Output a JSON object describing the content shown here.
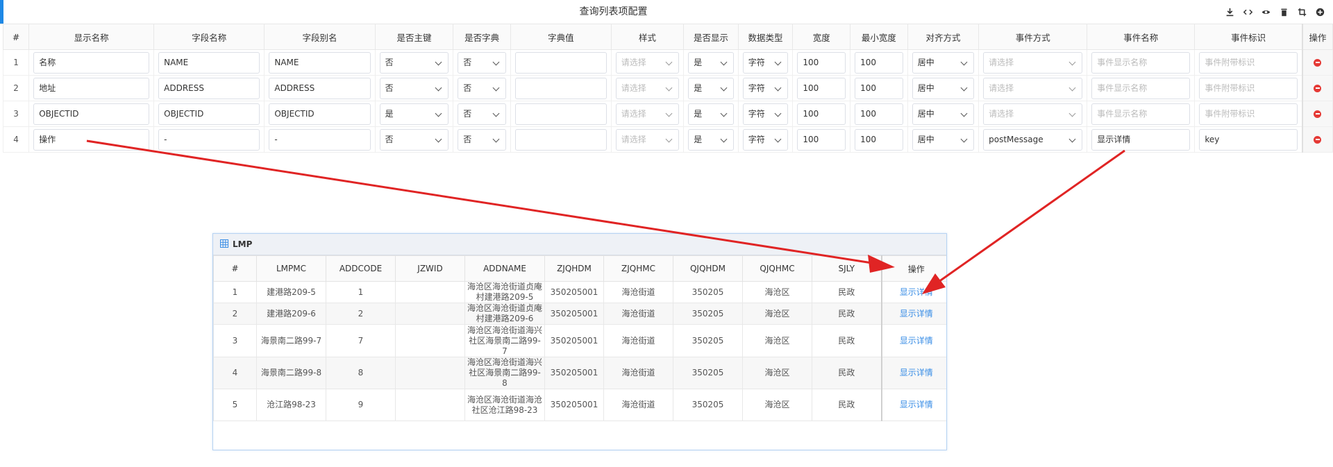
{
  "window": {
    "title": "查询列表项配置"
  },
  "toolbar_icons": [
    "download-icon",
    "code-icon",
    "eye-icon",
    "trash-icon",
    "crop-icon",
    "add-circle-icon"
  ],
  "config_table": {
    "headers": [
      "#",
      "显示名称",
      "字段名称",
      "字段别名",
      "是否主键",
      "是否字典",
      "字典值",
      "样式",
      "是否显示",
      "数据类型",
      "宽度",
      "最小宽度",
      "对齐方式",
      "事件方式",
      "事件名称",
      "事件标识",
      "操作"
    ],
    "placeholders": {
      "style": "请选择",
      "event_mode": "请选择",
      "event_name": "事件显示名称",
      "event_key": "事件附带标识"
    },
    "rows": [
      {
        "index": "1",
        "display_name": "名称",
        "field_name": "NAME",
        "field_alias": "NAME",
        "is_primary": "否",
        "is_dict": "否",
        "dict_value": "",
        "style": "",
        "visible": "是",
        "data_type": "字符",
        "width": "100",
        "min_width": "100",
        "align": "居中",
        "event_mode": "",
        "event_name": "",
        "event_key": ""
      },
      {
        "index": "2",
        "display_name": "地址",
        "field_name": "ADDRESS",
        "field_alias": "ADDRESS",
        "is_primary": "否",
        "is_dict": "否",
        "dict_value": "",
        "style": "",
        "visible": "是",
        "data_type": "字符",
        "width": "100",
        "min_width": "100",
        "align": "居中",
        "event_mode": "",
        "event_name": "",
        "event_key": ""
      },
      {
        "index": "3",
        "display_name": "OBJECTID",
        "field_name": "OBJECTID",
        "field_alias": "OBJECTID",
        "is_primary": "是",
        "is_dict": "否",
        "dict_value": "",
        "style": "",
        "visible": "是",
        "data_type": "字符",
        "width": "100",
        "min_width": "100",
        "align": "居中",
        "event_mode": "",
        "event_name": "",
        "event_key": ""
      },
      {
        "index": "4",
        "display_name": "操作",
        "field_name": "-",
        "field_alias": "-",
        "is_primary": "否",
        "is_dict": "否",
        "dict_value": "",
        "style": "",
        "visible": "是",
        "data_type": "字符",
        "width": "100",
        "min_width": "100",
        "align": "居中",
        "event_mode": "postMessage",
        "event_name": "显示详情",
        "event_key": "key"
      }
    ]
  },
  "preview": {
    "title": "LMP",
    "headers": [
      "#",
      "LMPMC",
      "ADDCODE",
      "JZWID",
      "ADDNAME",
      "ZJQHDM",
      "ZJQHMC",
      "QJQHDM",
      "QJQHMC",
      "SJLY",
      "操作"
    ],
    "rows": [
      {
        "index": "1",
        "lmpmc": "建港路209-5",
        "addcode": "1",
        "jzwid": "",
        "addname": "海沧区海沧街道贞庵村建港路209-5",
        "zjqhdm": "350205001",
        "zjqhmc": "海沧街道",
        "qjqhdm": "350205",
        "qjqhmc": "海沧区",
        "sjly": "民政",
        "action": "显示详情"
      },
      {
        "index": "2",
        "lmpmc": "建港路209-6",
        "addcode": "2",
        "jzwid": "",
        "addname": "海沧区海沧街道贞庵村建港路209-6",
        "zjqhdm": "350205001",
        "zjqhmc": "海沧街道",
        "qjqhdm": "350205",
        "qjqhmc": "海沧区",
        "sjly": "民政",
        "action": "显示详情"
      },
      {
        "index": "3",
        "lmpmc": "海景南二路99-7",
        "addcode": "7",
        "jzwid": "",
        "addname": "海沧区海沧街道海兴社区海景南二路99-7",
        "zjqhdm": "350205001",
        "zjqhmc": "海沧街道",
        "qjqhdm": "350205",
        "qjqhmc": "海沧区",
        "sjly": "民政",
        "action": "显示详情"
      },
      {
        "index": "4",
        "lmpmc": "海景南二路99-8",
        "addcode": "8",
        "jzwid": "",
        "addname": "海沧区海沧街道海兴社区海景南二路99-8",
        "zjqhdm": "350205001",
        "zjqhmc": "海沧街道",
        "qjqhdm": "350205",
        "qjqhmc": "海沧区",
        "sjly": "民政",
        "action": "显示详情"
      },
      {
        "index": "5",
        "lmpmc": "沧江路98-23",
        "addcode": "9",
        "jzwid": "",
        "addname": "海沧区海沧街道海沧社区沧江路98-23",
        "zjqhdm": "350205001",
        "zjqhmc": "海沧街道",
        "qjqhdm": "350205",
        "qjqhmc": "海沧区",
        "sjly": "民政",
        "action": "显示详情"
      }
    ]
  },
  "colors": {
    "accent": "#1e88e5",
    "link": "#3a8ee6",
    "delete": "#e53935",
    "annotation_arrow": "#e02424"
  }
}
